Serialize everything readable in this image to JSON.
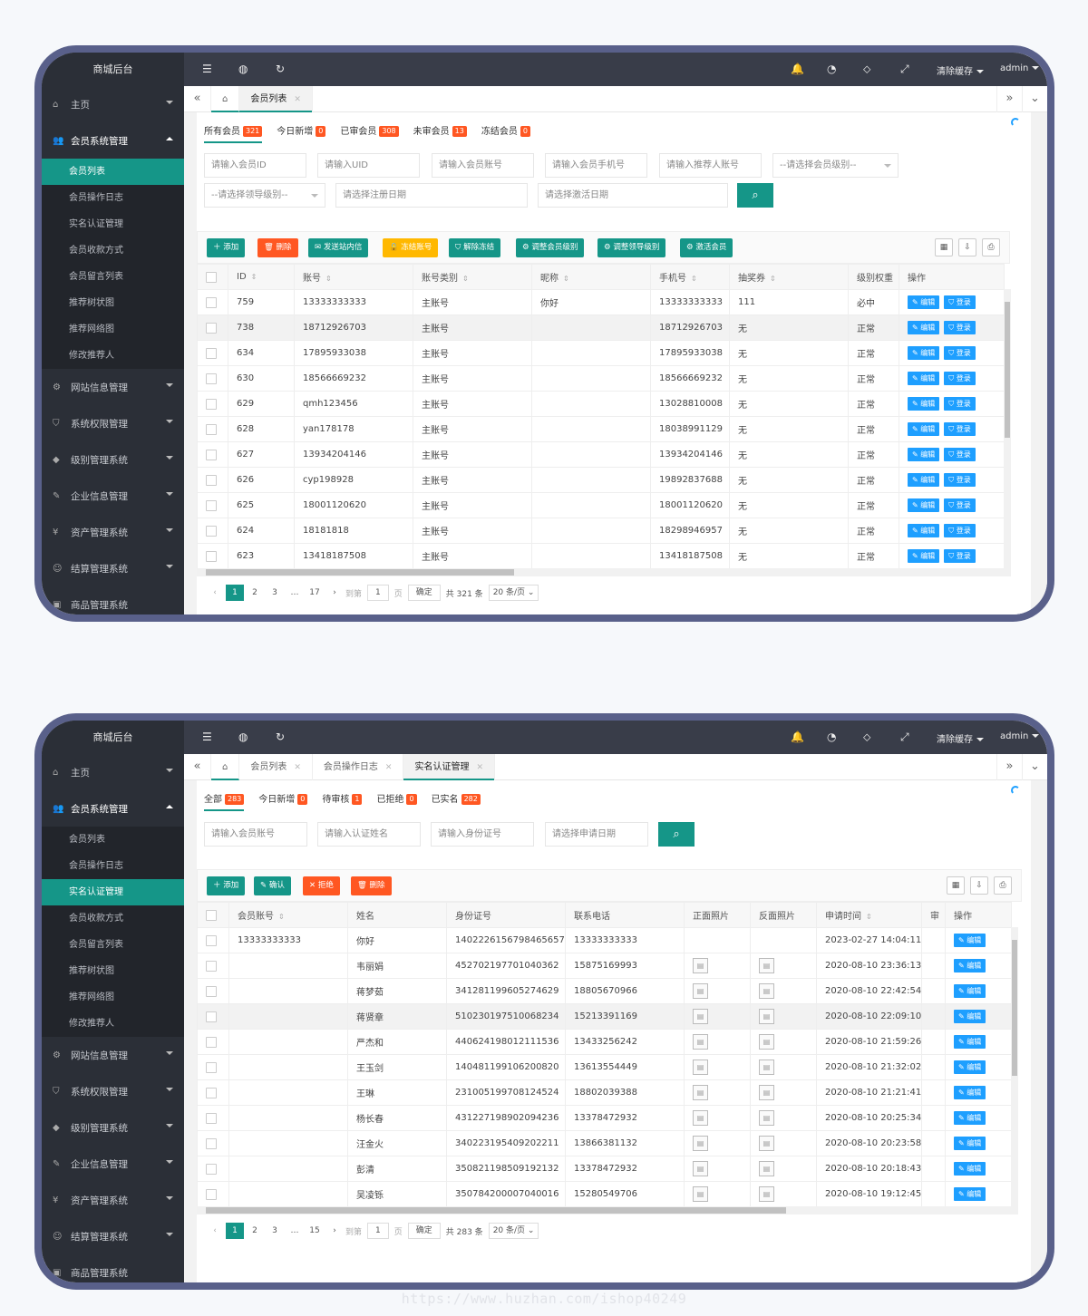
{
  "common": {
    "logo": "商城后台",
    "top_right": {
      "clear_cache": "清除缓存",
      "user": "admin"
    },
    "menu_home": "主页",
    "menu_member_system": "会员系统管理",
    "member_sub": [
      "会员列表",
      "会员操作日志",
      "实名认证管理",
      "会员收款方式",
      "会员留言列表",
      "推荐树状图",
      "推荐网络图",
      "修改推荐人"
    ],
    "menu_groups": [
      "网站信息管理",
      "系统权限管理",
      "级别管理系统",
      "企业信息管理",
      "资产管理系统",
      "结算管理系统"
    ],
    "menu_cut": "商品管理系统",
    "pager_goto": "到第",
    "pager_page": "页",
    "pager_confirm": "确定",
    "pager_ellipsis": "…",
    "pager_pages": [
      "1",
      "2",
      "3"
    ],
    "pager_input": "1"
  },
  "screen1": {
    "tabs": [
      {
        "label": "会员列表"
      }
    ],
    "stats": [
      {
        "label": "所有会员",
        "count": "321"
      },
      {
        "label": "今日新增",
        "count": "0"
      },
      {
        "label": "已审会员",
        "count": "308"
      },
      {
        "label": "未审会员",
        "count": "13"
      },
      {
        "label": "冻结会员",
        "count": "0"
      }
    ],
    "filters": [
      "请输入会员ID",
      "请输入UID",
      "请输入会员账号",
      "请输入会员手机号",
      "请输入推荐人账号",
      "--请选择会员级别--",
      "--请选择领导级别--",
      "请选择注册日期",
      "请选择激活日期"
    ],
    "buttons": [
      "添加",
      "删除",
      "发送站内信",
      "冻结账号",
      "解除冻结",
      "调整会员级别",
      "调整领导级别",
      "激活会员"
    ],
    "columns": [
      "ID",
      "账号",
      "账号类别",
      "昵称",
      "手机号",
      "抽奖券",
      "级别权重",
      "操作"
    ],
    "row_actions": {
      "edit": "编辑",
      "login": "登录"
    },
    "rows": [
      [
        "759",
        "13333333333",
        "主账号",
        "你好",
        "13333333333",
        "111",
        "必中"
      ],
      [
        "738",
        "18712926703",
        "主账号",
        "",
        "18712926703",
        "无",
        "正常"
      ],
      [
        "634",
        "17895933038",
        "主账号",
        "",
        "17895933038",
        "无",
        "正常"
      ],
      [
        "630",
        "18566669232",
        "主账号",
        "",
        "18566669232",
        "无",
        "正常"
      ],
      [
        "629",
        "qmh123456",
        "主账号",
        "",
        "13028810008",
        "无",
        "正常"
      ],
      [
        "628",
        "yan178178",
        "主账号",
        "",
        "18038991129",
        "无",
        "正常"
      ],
      [
        "627",
        "13934204146",
        "主账号",
        "",
        "13934204146",
        "无",
        "正常"
      ],
      [
        "626",
        "cyp198928",
        "主账号",
        "",
        "19892837688",
        "无",
        "正常"
      ],
      [
        "625",
        "18001120620",
        "主账号",
        "",
        "18001120620",
        "无",
        "正常"
      ],
      [
        "624",
        "18181818",
        "主账号",
        "",
        "18298946957",
        "无",
        "正常"
      ],
      [
        "623",
        "13418187508",
        "主账号",
        "",
        "13418187508",
        "无",
        "正常"
      ]
    ],
    "pager": {
      "last": "17",
      "total": "共 321 条",
      "per": "20 条/页"
    }
  },
  "screen2": {
    "tabs": [
      {
        "label": "会员列表"
      },
      {
        "label": "会员操作日志"
      },
      {
        "label": "实名认证管理"
      }
    ],
    "stats": [
      {
        "label": "全部",
        "count": "283"
      },
      {
        "label": "今日新增",
        "count": "0"
      },
      {
        "label": "待审核",
        "count": "1"
      },
      {
        "label": "已拒绝",
        "count": "0"
      },
      {
        "label": "已实名",
        "count": "282"
      }
    ],
    "filters": [
      "请输入会员账号",
      "请输入认证姓名",
      "请输入身份证号",
      "请选择申请日期"
    ],
    "buttons": [
      "添加",
      "确认",
      "拒绝",
      "删除"
    ],
    "columns": [
      "会员账号",
      "姓名",
      "身份证号",
      "联系电话",
      "正面照片",
      "反面照片",
      "申请时间",
      "审",
      "操作"
    ],
    "row_actions": {
      "edit": "编辑"
    },
    "rows": [
      [
        "13333333333",
        "你好",
        "140222615679846565​7",
        "13333333333",
        "2023-02-27 14:04:11"
      ],
      [
        "",
        "韦丽娟",
        "452702197701040362",
        "15875169993",
        "2020-08-10 23:36:13"
      ],
      [
        "",
        "蒋梦茹",
        "341281199605274629",
        "18805670966",
        "2020-08-10 22:42:54"
      ],
      [
        "",
        "蒋贤章",
        "510230197510068234",
        "15213391169",
        "2020-08-10 22:09:10"
      ],
      [
        "",
        "严杰和",
        "440624198012111536",
        "13433256242",
        "2020-08-10 21:59:26"
      ],
      [
        "",
        "王玉剑",
        "140481199106200820",
        "13613554449",
        "2020-08-10 21:32:02"
      ],
      [
        "",
        "王琳",
        "231005199708124524",
        "18802039388",
        "2020-08-10 21:21:41"
      ],
      [
        "",
        "杨长春",
        "431227198902094236",
        "13378472932",
        "2020-08-10 20:25:34"
      ],
      [
        "",
        "汪金火",
        "340223195409202211",
        "13866381132",
        "2020-08-10 20:23:58"
      ],
      [
        "",
        "彭清",
        "350821198509192132",
        "13378472932",
        "2020-08-10 20:18:43"
      ],
      [
        "",
        "吴凌铄",
        "350784200007040016",
        "15280549706",
        "2020-08-10 19:12:45"
      ]
    ],
    "pager": {
      "last": "15",
      "total": "共 283 条",
      "per": "20 条/页"
    }
  },
  "watermark": "https://www.huzhan.com/ishop40249",
  "colors": {
    "sidebar": "#2b2f37",
    "topbar": "#393d49",
    "accent": "#159688",
    "danger": "#ff5722",
    "warn": "#ffb800",
    "blue": "#1e9fff",
    "frame": "#59608a"
  }
}
